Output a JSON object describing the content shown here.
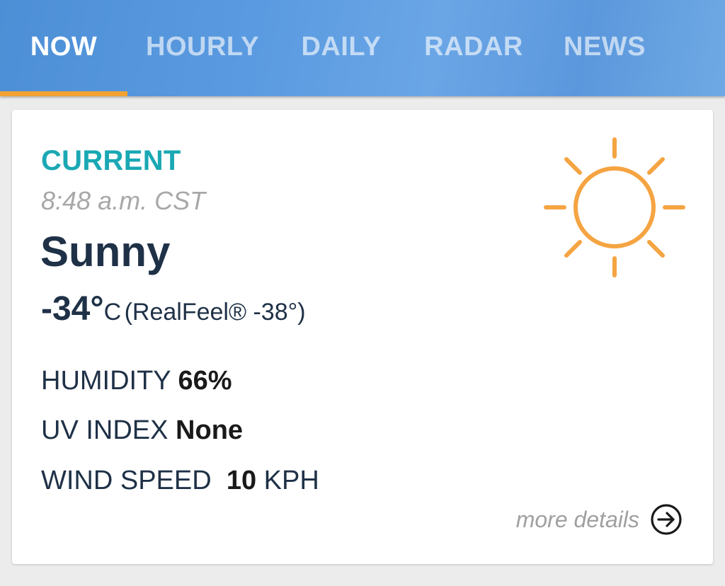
{
  "tabs": [
    {
      "label": "NOW",
      "active": true
    },
    {
      "label": "HOURLY",
      "active": false
    },
    {
      "label": "DAILY",
      "active": false
    },
    {
      "label": "RADAR",
      "active": false
    },
    {
      "label": "NEWS",
      "active": false
    }
  ],
  "colors": {
    "tab_bar": "#5a9ae0",
    "indicator": "#f2a232",
    "accent": "#1aa8b4",
    "sun": "#f5a442",
    "primary_text": "#1f3147"
  },
  "current": {
    "label": "CURRENT",
    "time": "8:48 a.m. CST",
    "condition": "Sunny",
    "condition_icon": "sun-icon",
    "temperature": "-34°",
    "unit": "C",
    "realfeel": "(RealFeel® -38°)",
    "stats": {
      "humidity_label": "HUMIDITY",
      "humidity_value": "66%",
      "uv_label": "UV INDEX",
      "uv_value": "None",
      "wind_label": "WIND SPEED",
      "wind_value": "10",
      "wind_unit": "KPH"
    },
    "more_details": "more details",
    "more_details_icon": "arrow-circle-right-icon"
  }
}
